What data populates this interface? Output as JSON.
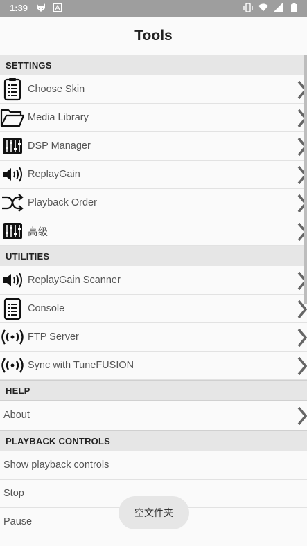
{
  "status_bar": {
    "time": "1:39",
    "left_icons": [
      "fox-icon",
      "a-notification-icon"
    ],
    "right_icons": [
      "vibrate-icon",
      "wifi-icon",
      "signal-icon",
      "battery-icon"
    ]
  },
  "header": {
    "title": "Tools"
  },
  "sections": [
    {
      "title": "SETTINGS",
      "items": [
        {
          "label": "Choose Skin",
          "icon": "clipboard-list-icon",
          "chevron": true
        },
        {
          "label": "Media Library",
          "icon": "folder-open-icon",
          "chevron": true
        },
        {
          "label": "DSP Manager",
          "icon": "equalizer-icon",
          "chevron": true
        },
        {
          "label": "ReplayGain",
          "icon": "speaker-icon",
          "chevron": true
        },
        {
          "label": "Playback Order",
          "icon": "shuffle-icon",
          "chevron": true
        },
        {
          "label": "高级",
          "icon": "equalizer-icon",
          "chevron": true
        }
      ]
    },
    {
      "title": "UTILITIES",
      "items": [
        {
          "label": "ReplayGain Scanner",
          "icon": "speaker-icon",
          "chevron": true
        },
        {
          "label": "Console",
          "icon": "clipboard-list-icon",
          "chevron": true
        },
        {
          "label": "FTP Server",
          "icon": "broadcast-icon",
          "chevron": true
        },
        {
          "label": "Sync with TuneFUSION",
          "icon": "broadcast-icon",
          "chevron": true
        }
      ]
    },
    {
      "title": "HELP",
      "items": [
        {
          "label": "About",
          "icon": "",
          "chevron": true
        }
      ]
    },
    {
      "title": "PLAYBACK CONTROLS",
      "items": [
        {
          "label": "Show playback controls",
          "icon": "",
          "chevron": false
        },
        {
          "label": "Stop",
          "icon": "",
          "chevron": false
        },
        {
          "label": "Pause",
          "icon": "",
          "chevron": false
        }
      ]
    }
  ],
  "toast": {
    "text": "空文件夹"
  }
}
